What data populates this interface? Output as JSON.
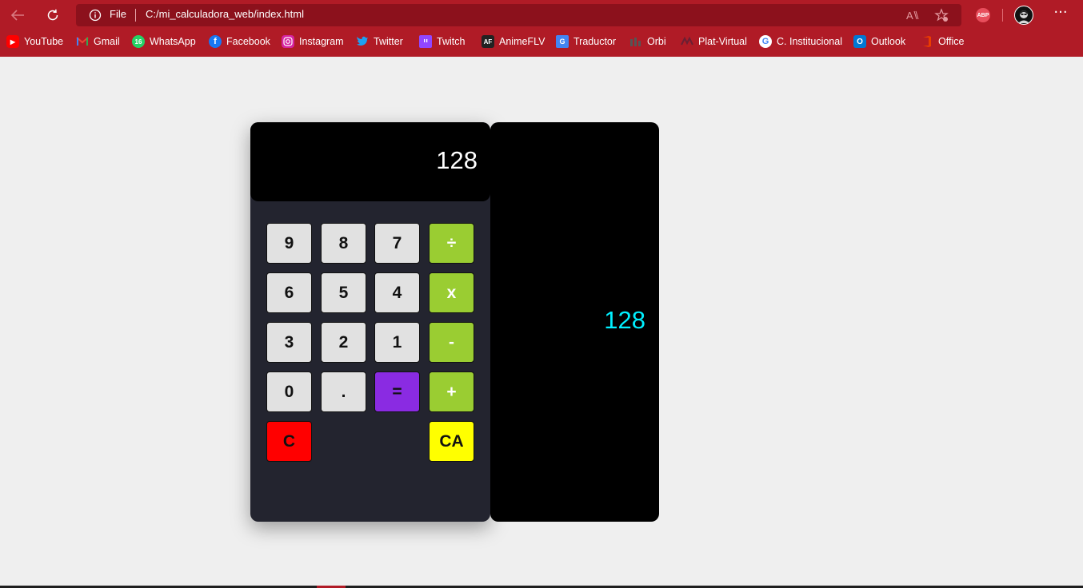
{
  "browser": {
    "address_scheme": "File",
    "address_url": "C:/mi_calculadora_web/index.html",
    "adblock_label": "ABP",
    "more_label": "···",
    "accent_color": "#b01b26"
  },
  "bookmarks": [
    {
      "label": "YouTube",
      "icon": "youtube-icon",
      "color": "#ff0000"
    },
    {
      "label": "Gmail",
      "icon": "gmail-icon",
      "color": "#ea4335"
    },
    {
      "label": "WhatsApp",
      "icon": "whatsapp-icon",
      "color": "#25d366",
      "badge": "16"
    },
    {
      "label": "Facebook",
      "icon": "facebook-icon",
      "color": "#1877f2"
    },
    {
      "label": "Instagram",
      "icon": "instagram-icon",
      "color": "#d6249f"
    },
    {
      "label": "Twitter",
      "icon": "twitter-icon",
      "color": "#1da1f2"
    },
    {
      "label": "Twitch",
      "icon": "twitch-icon",
      "color": "#9146ff"
    },
    {
      "label": "AnimeFLV",
      "icon": "animeflv-icon",
      "color": "#222222",
      "badge": "AF"
    },
    {
      "label": "Traductor",
      "icon": "translate-icon",
      "color": "#4285f4"
    },
    {
      "label": "Orbi",
      "icon": "orbi-icon",
      "color": "#444444"
    },
    {
      "label": "Plat-Virtual",
      "icon": "plat-virtual-icon",
      "color": "#5a1a2a"
    },
    {
      "label": "C. Institucional",
      "icon": "google-icon",
      "color": "#ffffff"
    },
    {
      "label": "Outlook",
      "icon": "outlook-icon",
      "color": "#0078d4"
    },
    {
      "label": "Office",
      "icon": "office-icon",
      "color": "#eb3c00"
    }
  ],
  "calculator": {
    "display_value": "128",
    "history_value": "128",
    "keys": {
      "k9": "9",
      "k8": "8",
      "k7": "7",
      "div": "÷",
      "k6": "6",
      "k5": "5",
      "k4": "4",
      "mul": "x",
      "k3": "3",
      "k2": "2",
      "k1": "1",
      "sub": "-",
      "k0": "0",
      "dot": ".",
      "eq": "=",
      "add": "+",
      "clear": "C",
      "clear_all": "CA"
    },
    "colors": {
      "operator": "#9acd32",
      "equals": "#8a2be2",
      "clear": "#ff0000",
      "clear_all": "#ffff00",
      "history_text": "#00f0ff"
    }
  }
}
